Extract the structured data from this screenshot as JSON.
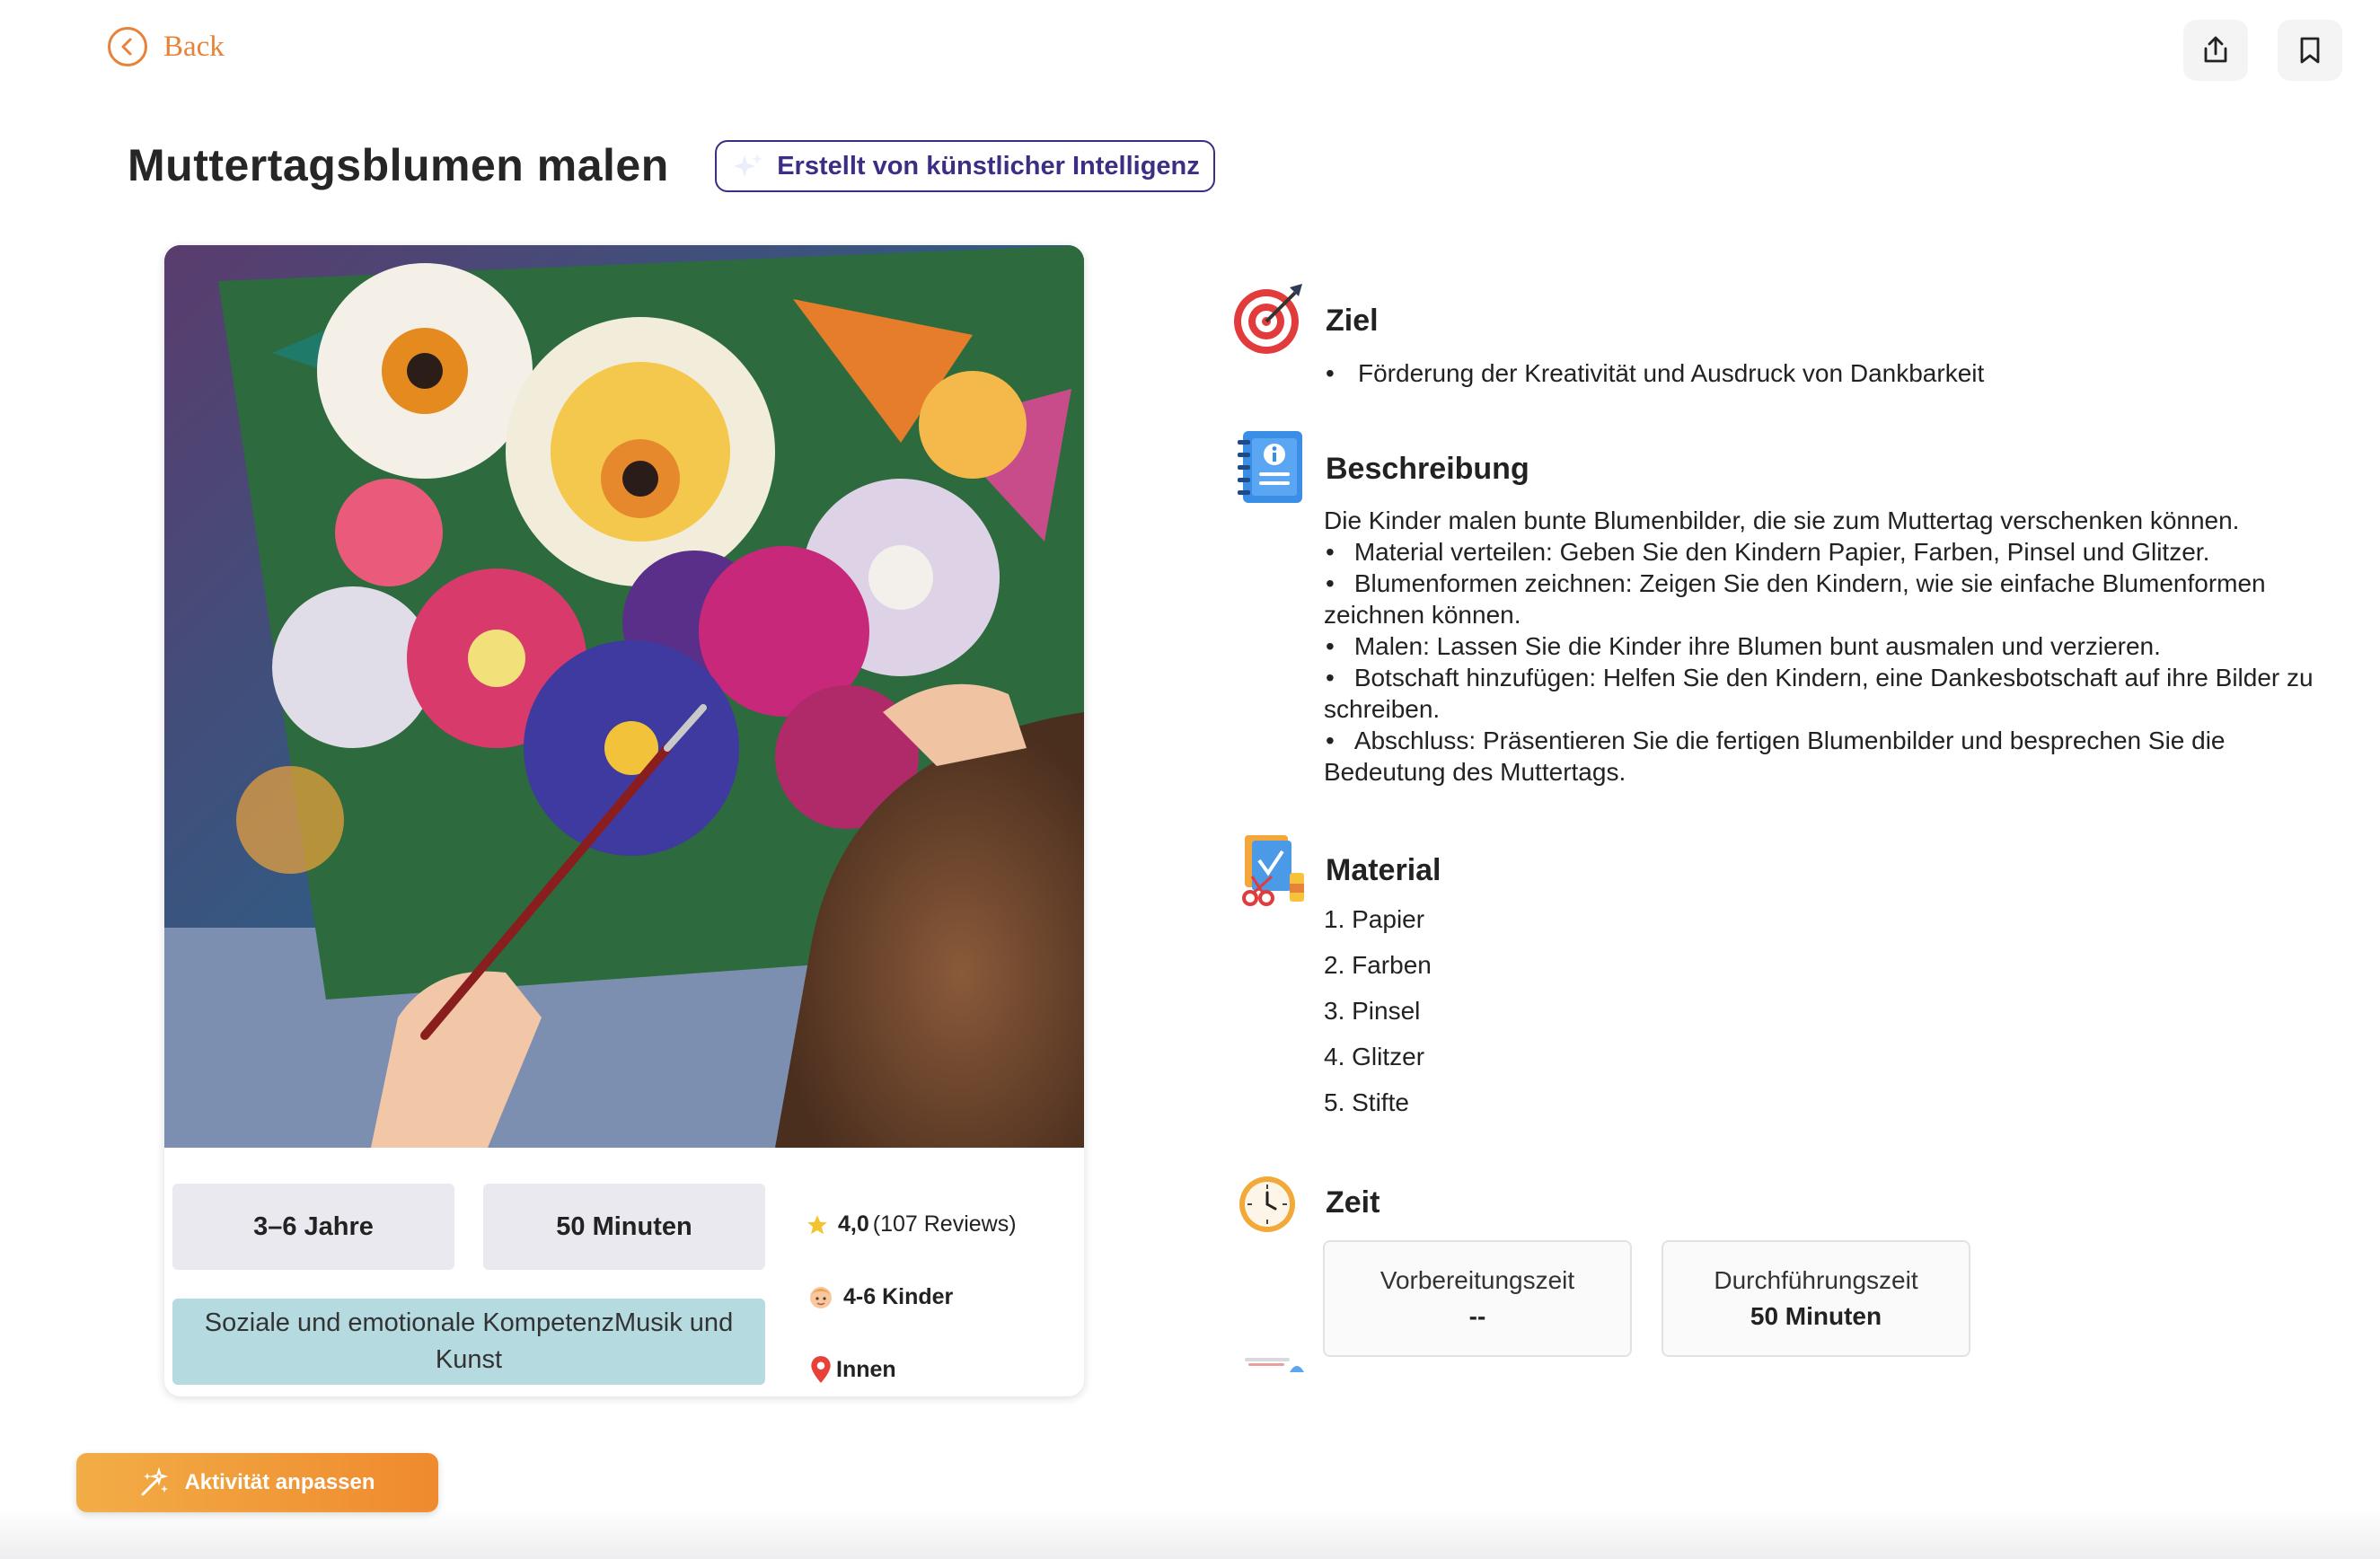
{
  "nav": {
    "back_label": "Back"
  },
  "activity": {
    "title": "Muttertagsblumen malen",
    "ai_badge": "Erstellt von künstlicher Intelligenz",
    "age": "3–6 Jahre",
    "duration": "50 Minuten",
    "topics": "Soziale und emotionale KompetenzMusik und Kunst",
    "rating_value": "4,0",
    "rating_count": "(107 Reviews)",
    "group_size": "4-6 Kinder",
    "location": "Innen"
  },
  "ziel": {
    "title": "Ziel",
    "items": [
      "Förderung der Kreativität und Ausdruck von Dankbarkeit"
    ]
  },
  "beschreibung": {
    "title": "Beschreibung",
    "intro": "Die Kinder malen bunte Blumenbilder, die sie zum Muttertag verschenken können.",
    "steps": [
      "Material verteilen: Geben Sie den Kindern Papier, Farben, Pinsel und Glitzer.",
      "Blumenformen zeichnen: Zeigen Sie den Kindern, wie sie einfache Blumenformen zeichnen können.",
      "Malen: Lassen Sie die Kinder ihre Blumen bunt ausmalen und verzieren.",
      "Botschaft hinzufügen: Helfen Sie den Kindern, eine Dankesbotschaft auf ihre Bilder zu schreiben.",
      "Abschluss: Präsentieren Sie die fertigen Blumenbilder und besprechen Sie die Bedeutung des Muttertags."
    ]
  },
  "material": {
    "title": "Material",
    "items": [
      "1. Papier",
      "2. Farben",
      "3. Pinsel",
      "4. Glitzer",
      "5. Stifte"
    ]
  },
  "zeit": {
    "title": "Zeit",
    "prep_label": "Vorbereitungszeit",
    "prep_value": "--",
    "exec_label": "Durchführungszeit",
    "exec_value": "50 Minuten"
  },
  "cta": {
    "label": "Aktivität anpassen"
  },
  "colors": {
    "accent": "#e8823a",
    "ai_badge": "#3a2f84",
    "chip": "#ebe9f0",
    "topic_chip": "#b5dbe0"
  }
}
